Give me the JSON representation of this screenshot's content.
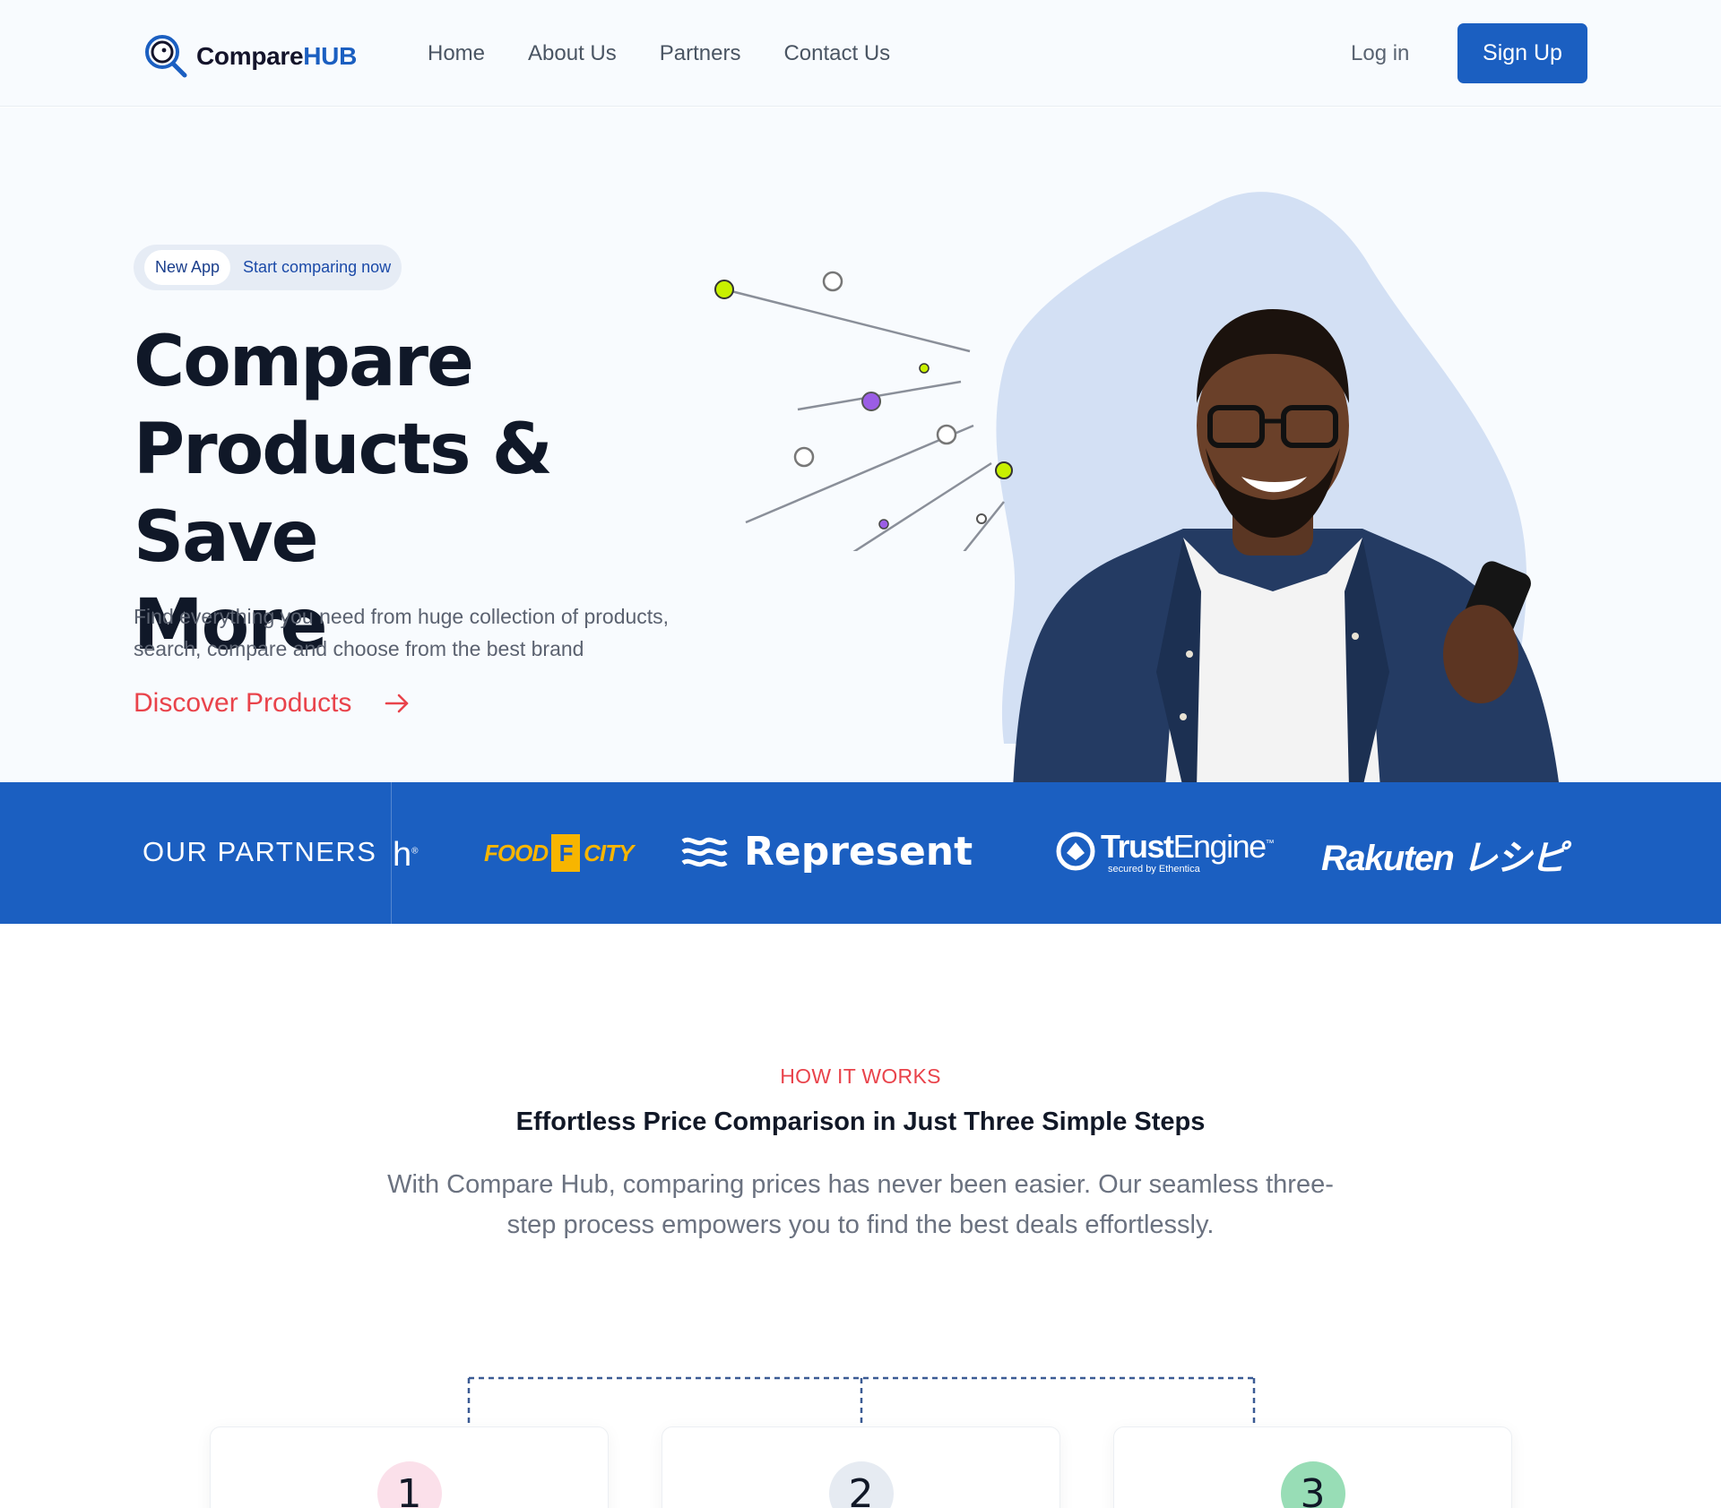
{
  "brand": {
    "name_part1": "Compare",
    "name_part2": "HUB",
    "icon": "magnifier-logo-icon"
  },
  "nav": {
    "links": [
      "Home",
      "About Us",
      "Partners",
      "Contact Us"
    ],
    "login": "Log in",
    "signup": "Sign Up"
  },
  "hero": {
    "badge_tag": "New App",
    "badge_text": "Start comparing now",
    "title_line1": "Compare",
    "title_line2": "Products & Save",
    "title_line3": "More",
    "subtitle": "Find everything you need from huge collection of products, search, compare and choose from the best brand",
    "cta": "Discover Products",
    "cta_icon": "arrow-right-icon"
  },
  "partners": {
    "label": "OUR PARTNERS",
    "logos": {
      "partial": "h",
      "food_city_1": "FOOD",
      "food_city_box": "F",
      "food_city_2": "CITY",
      "represent": "Represent",
      "trust_bold": "Trust",
      "trust_light": "Engine",
      "trust_tm": "™",
      "trust_sub": "secured by Ethentica",
      "rakuten": "Rakuten レシピ"
    }
  },
  "how": {
    "eyebrow": "HOW IT WORKS",
    "title": "Effortless Price Comparison in Just Three Simple Steps",
    "description": "With Compare Hub, comparing prices has never been easier. Our seamless three-step process empowers you to find the best deals effortlessly.",
    "steps": [
      {
        "number": "1",
        "color": "#fbe0ea"
      },
      {
        "number": "2",
        "color": "#e6ebf2"
      },
      {
        "number": "3",
        "color": "#98ddb6"
      }
    ]
  },
  "colors": {
    "primary": "#1b5fc1",
    "accent": "#e9434b",
    "dark": "#101828"
  }
}
